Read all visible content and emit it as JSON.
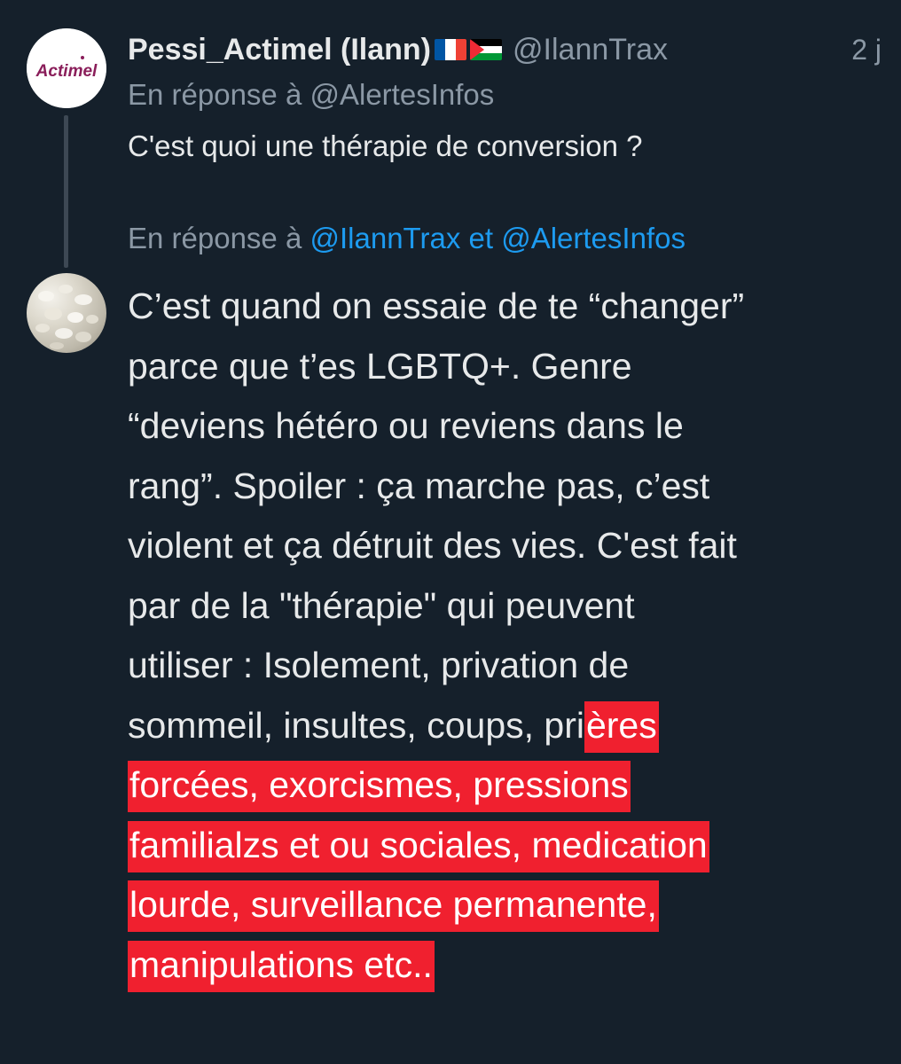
{
  "tweet1": {
    "avatar_text": "Actimel",
    "display_name": "Pessi_Actimel (Ilann)",
    "flags": [
      "france-flag",
      "palestine-flag"
    ],
    "handle": "@IlannTrax",
    "time": "2 j",
    "reply_prefix": "En réponse à",
    "reply_mention": "@AlertesInfos",
    "text": "C'est quoi une thérapie de conversion ?"
  },
  "tweet2": {
    "reply_prefix": "En réponse à",
    "reply_mention_1": "@IlannTrax",
    "reply_and": "et",
    "reply_mention_2": "@AlertesInfos",
    "lines": [
      "C’est quand on essaie de te “changer”",
      "parce que t’es LGBTQ+. Genre",
      "“deviens hétéro ou reviens dans le",
      "rang”. Spoiler : ça marche pas, c’est",
      "violent et ça détruit des vies. C'est fait",
      "par de la \"thérapie\" qui peuvent",
      "utiliser : Isolement, privation de"
    ],
    "line8_plain": "sommeil, insultes, coups, pri",
    "line8_highlight": "ères",
    "highlighted_lines": [
      "forcées, exorcismes, pressions",
      "familialzs et ou sociales, medication",
      "lourde, surveillance permanente,",
      "manipulations etc.."
    ],
    "highlight_color": "#f0202f"
  },
  "colors": {
    "background": "#15202b",
    "text": "#e7e9ea",
    "muted": "#8b98a5",
    "link": "#1d9bf0",
    "thread_line": "#3d4854"
  }
}
